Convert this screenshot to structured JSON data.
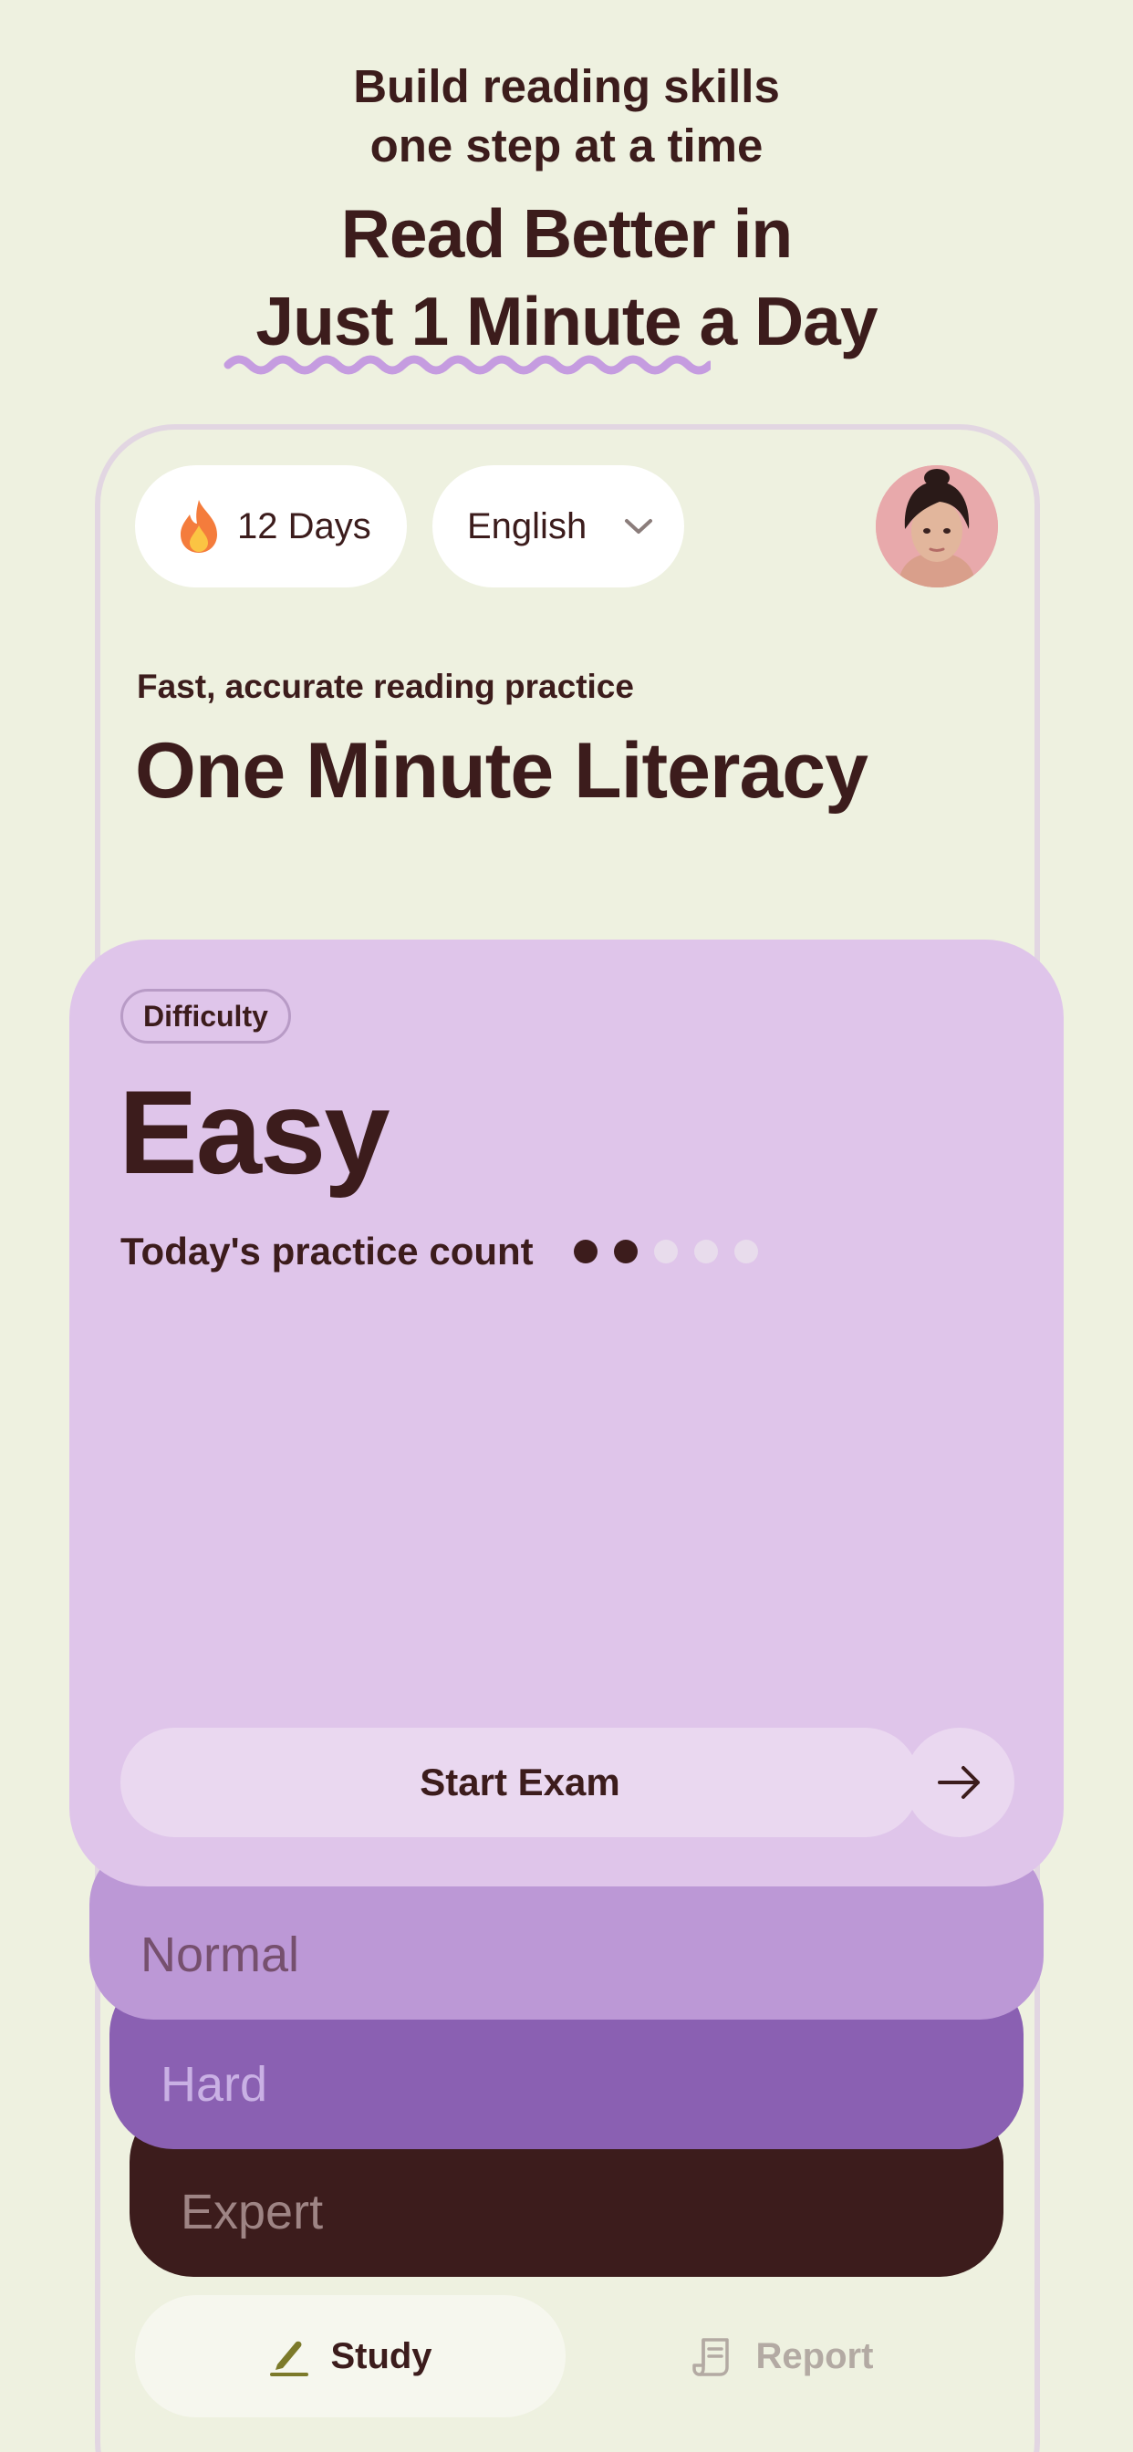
{
  "promo": {
    "subtitle_line1": "Build reading skills",
    "subtitle_line2": "one step at a time",
    "title_line1": "Read Better in",
    "title_line2": "Just 1 Minute a Day"
  },
  "header": {
    "streak_label": "12 Days",
    "language_label": "English"
  },
  "section": {
    "subtitle": "Fast, accurate reading practice",
    "title": "One Minute Literacy"
  },
  "card": {
    "badge": "Difficulty",
    "level": "Easy",
    "practice_label": "Today's practice count",
    "practice_done": 2,
    "practice_total": 5,
    "start_label": "Start Exam"
  },
  "deck": {
    "normal": "Normal",
    "hard": "Hard",
    "expert": "Expert"
  },
  "tabs": {
    "study": "Study",
    "report": "Report"
  },
  "colors": {
    "background": "#eef1e0",
    "text": "#3c1c1c",
    "easy": "#dfc5ea",
    "normal": "#bc98d6",
    "hard": "#8a60b2",
    "expert": "#3c1c1c",
    "accent_squiggle": "#c59ce0"
  }
}
